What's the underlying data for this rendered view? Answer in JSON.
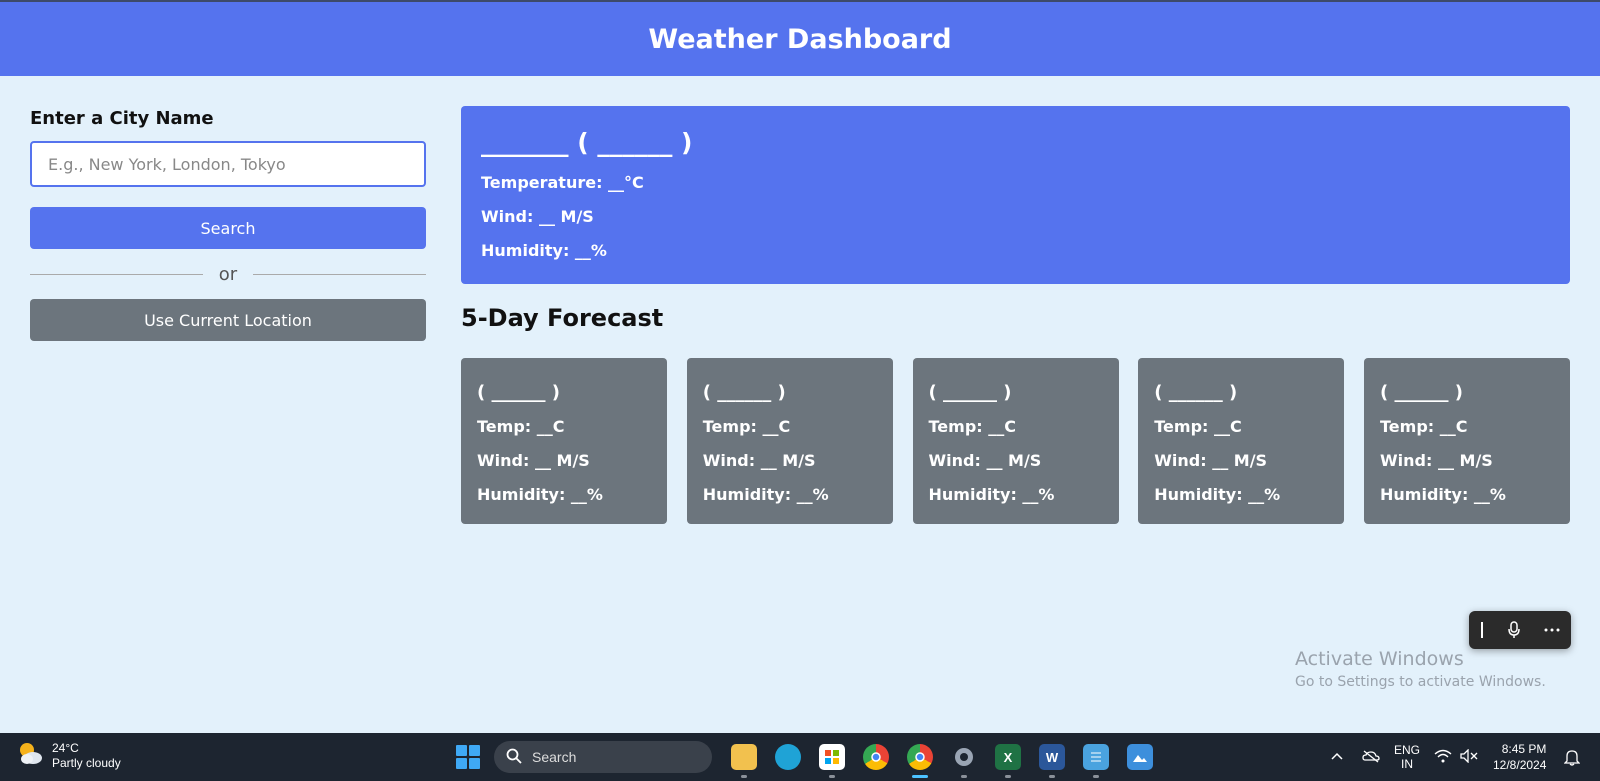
{
  "header": {
    "title": "Weather Dashboard"
  },
  "sidebar": {
    "label": "Enter a City Name",
    "city_input": {
      "placeholder": "E.g., New York, London, Tokyo",
      "value": ""
    },
    "search_label": "Search",
    "or_label": "or",
    "location_label": "Use Current Location"
  },
  "current": {
    "city": "_______ ( ______ )",
    "temperature": "Temperature: __°C",
    "wind": "Wind: __ M/S",
    "humidity": "Humidity: __%"
  },
  "forecast": {
    "title": "5-Day Forecast",
    "cards": [
      {
        "date": "( ______ )",
        "temp": "Temp: __C",
        "wind": "Wind: __ M/S",
        "humidity": "Humidity: __%"
      },
      {
        "date": "( ______ )",
        "temp": "Temp: __C",
        "wind": "Wind: __ M/S",
        "humidity": "Humidity: __%"
      },
      {
        "date": "( ______ )",
        "temp": "Temp: __C",
        "wind": "Wind: __ M/S",
        "humidity": "Humidity: __%"
      },
      {
        "date": "( ______ )",
        "temp": "Temp: __C",
        "wind": "Wind: __ M/S",
        "humidity": "Humidity: __%"
      },
      {
        "date": "( ______ )",
        "temp": "Temp: __C",
        "wind": "Wind: __ M/S",
        "humidity": "Humidity: __%"
      }
    ]
  },
  "watermark": {
    "line1": "Activate Windows",
    "line2": "Go to Settings to activate Windows."
  },
  "taskbar": {
    "weather_temp": "24°C",
    "weather_desc": "Partly cloudy",
    "search_label": "Search",
    "apps": [
      "file-explorer",
      "edge",
      "store",
      "chrome",
      "chrome-profile",
      "settings",
      "excel",
      "word",
      "notepad",
      "photos"
    ],
    "lang_line1": "ENG",
    "lang_line2": "IN",
    "time": "8:45 PM",
    "date": "12/8/2024"
  },
  "colors": {
    "primary": "#5573ee",
    "secondary": "#6c757d",
    "background": "#e3f1fb"
  }
}
